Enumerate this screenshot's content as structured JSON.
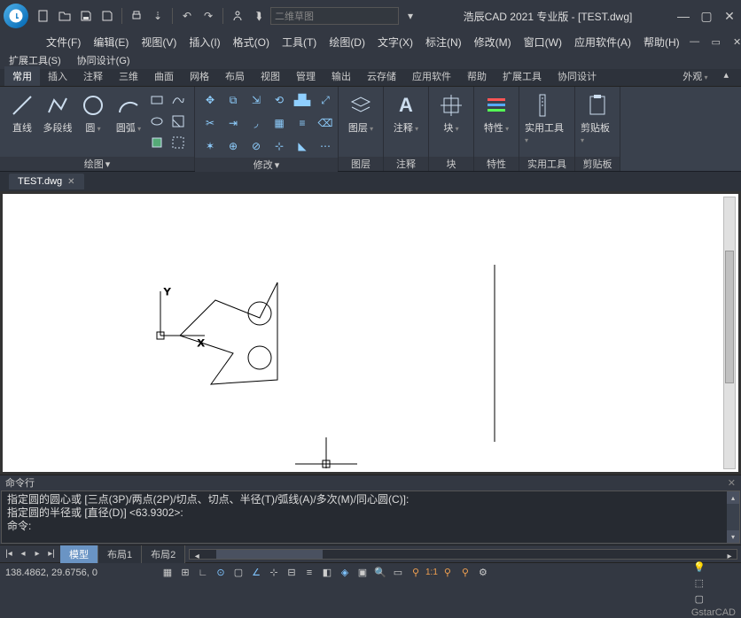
{
  "title": "浩辰CAD 2021 专业版 - [TEST.dwg]",
  "search_placeholder": "二维草图",
  "menubar": [
    "文件(F)",
    "编辑(E)",
    "视图(V)",
    "插入(I)",
    "格式(O)",
    "工具(T)",
    "绘图(D)",
    "文字(X)",
    "标注(N)",
    "修改(M)",
    "窗口(W)",
    "应用软件(A)",
    "帮助(H)"
  ],
  "menubar2": [
    "扩展工具(S)",
    "协同设计(G)"
  ],
  "ribbon_tabs": [
    "常用",
    "插入",
    "注释",
    "三维",
    "曲面",
    "网格",
    "布局",
    "视图",
    "管理",
    "输出",
    "云存储",
    "应用软件",
    "帮助",
    "扩展工具",
    "协同设计"
  ],
  "ribbon_tabs_right": [
    "外观"
  ],
  "active_ribbon_tab": "常用",
  "panels": {
    "draw": {
      "title": "绘图",
      "big": [
        "直线",
        "多段线",
        "圆",
        "圆弧"
      ]
    },
    "modify": {
      "title": "修改"
    },
    "layer": {
      "title": "图层",
      "label": "图层"
    },
    "annotate": {
      "title": "注释",
      "label": "注释"
    },
    "block": {
      "title": "块",
      "label": "块"
    },
    "properties": {
      "title": "特性",
      "label": "特性"
    },
    "utilities": {
      "title": "实用工具",
      "label": "实用工具"
    },
    "clipboard": {
      "title": "剪贴板",
      "label": "剪贴板"
    }
  },
  "doc_tab": "TEST.dwg",
  "command": {
    "title": "命令行",
    "lines": [
      "指定圆的圆心或 [三点(3P)/两点(2P)/切点、切点、半径(T)/弧线(A)/多次(M)/同心圆(C)]:",
      "指定圆的半径或 [直径(D)] <63.9302>:",
      "命令: "
    ]
  },
  "layout_tabs": [
    "模型",
    "布局1",
    "布局2"
  ],
  "active_layout_tab": "模型",
  "coords": "138.4862, 29.6756, 0",
  "scale": "1:1",
  "brand": "GstarCAD",
  "ucs": {
    "y": "Y",
    "x": "X"
  }
}
